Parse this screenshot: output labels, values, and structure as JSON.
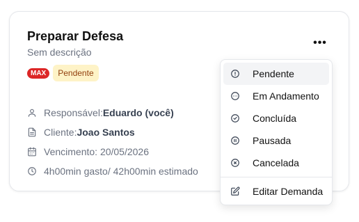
{
  "card": {
    "title": "Preparar Defesa",
    "description": "Sem descrição",
    "priority_badge": "MAX",
    "status_badge": "Pendente",
    "more_label": "•••",
    "responsible_label": "Responsável: ",
    "responsible_value": "Eduardo (você)",
    "client_label": "Cliente: ",
    "client_value": "Joao Santos",
    "due": "Vencimento: 20/05/2026",
    "time": "4h00min gasto/ 42h00min estimado"
  },
  "menu": {
    "items": [
      {
        "label": "Pendente",
        "icon": "alert-circle-icon"
      },
      {
        "label": "Em Andamento",
        "icon": "dots-circle-icon"
      },
      {
        "label": "Concluída",
        "icon": "check-circle-icon"
      },
      {
        "label": "Pausada",
        "icon": "pause-circle-icon"
      },
      {
        "label": "Cancelada",
        "icon": "x-circle-icon"
      }
    ],
    "edit_label": "Editar Demanda",
    "edit_icon": "edit-icon"
  },
  "colors": {
    "priority": "#dc2626",
    "status_bg": "#fef3c7",
    "status_text": "#92400e"
  }
}
